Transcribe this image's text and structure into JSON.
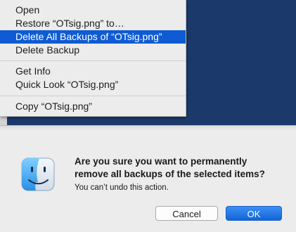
{
  "context_menu": {
    "items": [
      {
        "label": "Open"
      },
      {
        "label": "Restore “OTsig.png” to…"
      },
      {
        "label": "Delete All Backups of “OTsig.png”",
        "highlighted": true
      },
      {
        "label": "Delete Backup"
      },
      {
        "label": "Get Info"
      },
      {
        "label": "Quick Look “OTsig.png”"
      },
      {
        "label": "Copy “OTsig.png”"
      }
    ]
  },
  "dialog": {
    "icon": "finder-icon",
    "title_line1": "Are you sure you want to permanently",
    "title_line2": "remove all backups of the selected items?",
    "message": "You can’t undo this action.",
    "cancel_label": "Cancel",
    "ok_label": "OK"
  },
  "colors": {
    "desktop": "#1b3a6b",
    "menu_highlight": "#0f5bd3",
    "default_button": "#1464d6"
  }
}
